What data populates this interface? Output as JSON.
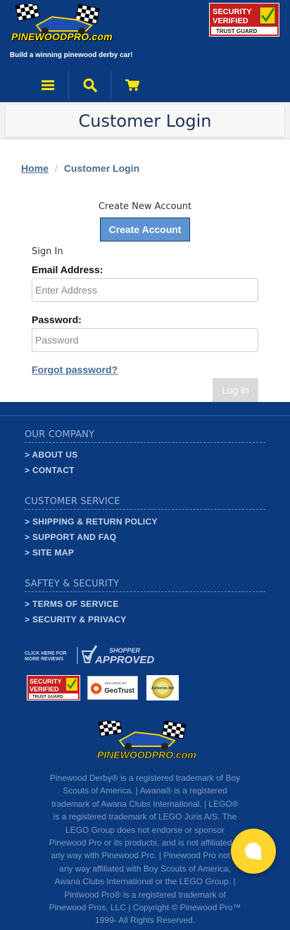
{
  "header": {
    "logo_text": "PINEWOODPRO.com",
    "tagline": "Build a winning pinewood derby car!",
    "trust_badge": {
      "line1": "SECURITY",
      "line2": "VERIFIED",
      "line3": "TRUST GUARD"
    }
  },
  "nav": {
    "icons": [
      "menu-icon",
      "search-icon",
      "cart-icon"
    ]
  },
  "page": {
    "title": "Customer Login"
  },
  "breadcrumb": {
    "home": "Home",
    "separator": "/",
    "current": "Customer Login"
  },
  "create_account": {
    "heading": "Create New Account",
    "button_label": "Create Account"
  },
  "sign_in": {
    "heading": "Sign In",
    "email_label": "Email Address:",
    "email_placeholder": "Enter Address",
    "password_label": "Password:",
    "password_placeholder": "Password",
    "forgot_label": "Forgot password?",
    "login_label": "Log In"
  },
  "footer": {
    "sections": [
      {
        "heading": "OUR COMPANY",
        "links": [
          "> ABOUT US",
          "> CONTACT"
        ]
      },
      {
        "heading": "CUSTOMER SERVICE",
        "links": [
          "> SHIPPING & RETURN POLICY",
          "> SUPPORT AND FAQ",
          "> SITE MAP"
        ]
      },
      {
        "heading": "SAFTEY & SECURITY",
        "links": [
          "> TERMS OF SERVICE",
          "> SECURITY & PRIVACY"
        ]
      }
    ],
    "shopper_approved": {
      "small_text_1": "CLICK HERE FOR",
      "small_text_2": "MORE REVIEWS",
      "brand_top": "SHOPPER",
      "brand_main": "APPROVED"
    },
    "badges": {
      "geotrust_small": "SECURED BY",
      "geotrust_name": "GeoTrust",
      "authorize_net": "Authorize.Net"
    },
    "legal": "Pinewood Derby® is a registered trademark of Boy Scouts of America. | Awana® is a registered trademark of Awana Clubs International. | LEGO® is a registered trademark of LEGO Juris A/S. The LEGO Group does not endorse or sponsor Pinewood Pro or its products, and is not affiliated in any way with Pinewood Pro. | Pinewood Pro not in any way affiliated with Boy Scouts of America, Awana Clubs International or the LEGO Group. | Pintwood Pro® is a registered trademark of Pinewood Pros, LLC | Copyright © Pinewood Pro™ 1999- All Rights Reserved."
  },
  "colors": {
    "navy": "#0b3a7e",
    "accent_yellow": "#ffe600",
    "button_blue": "#5d93d1",
    "chat_yellow": "#ffd52e"
  }
}
